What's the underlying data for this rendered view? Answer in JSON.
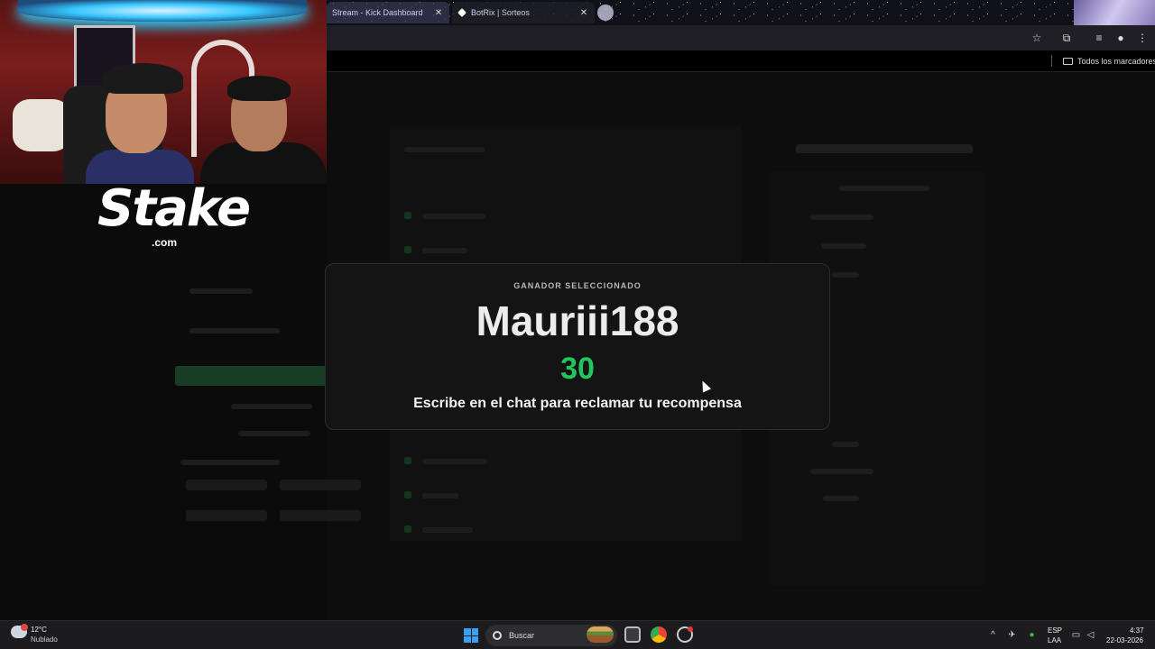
{
  "browser": {
    "tabs": [
      {
        "label": "Stream - Kick Dashboard",
        "active": false
      },
      {
        "label": "BotRix | Sorteos",
        "active": true
      }
    ],
    "bookmarks": {
      "all_bookmarks_label": "Todos los marcadores"
    }
  },
  "overlay": {
    "brand": {
      "name": "Stake",
      "suffix": ".com"
    }
  },
  "modal": {
    "label": "GANADOR SELECCIONADO",
    "winner": "Mauriii188",
    "countdown": "30",
    "instruction": "Escribe en el chat para reclamar tu recompensa",
    "accent_color": "#22c55e"
  },
  "taskbar": {
    "weather": {
      "temp": "12°C",
      "desc": "Nublado"
    },
    "search_label": "Buscar",
    "language": {
      "line1": "ESP",
      "line2": "LAA"
    },
    "clock": {
      "time": "4:37",
      "date": "22-03-2026"
    }
  }
}
